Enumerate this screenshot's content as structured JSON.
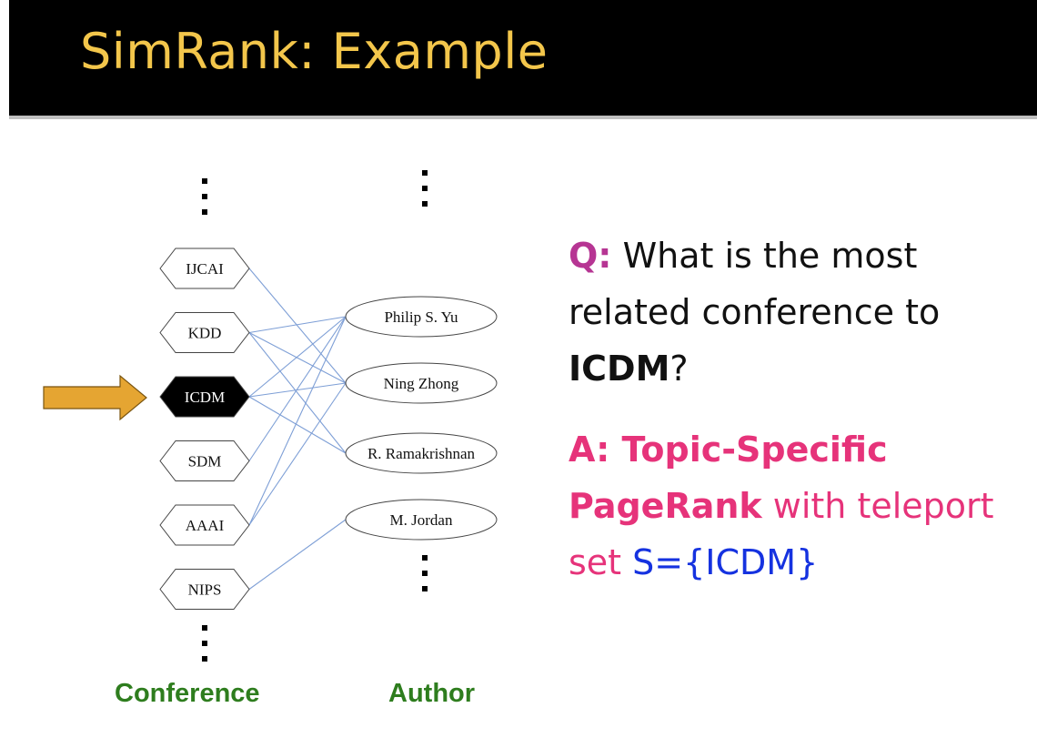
{
  "title": "SimRank: Example",
  "diagram": {
    "conferences": [
      "IJCAI",
      "KDD",
      "ICDM",
      "SDM",
      "AAAI",
      "NIPS"
    ],
    "highlighted_conference": "ICDM",
    "authors": [
      "Philip S. Yu",
      "Ning Zhong",
      "R. Ramakrishnan",
      "M. Jordan"
    ],
    "edges": [
      [
        "IJCAI",
        "Ning Zhong"
      ],
      [
        "KDD",
        "Philip S. Yu"
      ],
      [
        "KDD",
        "Ning Zhong"
      ],
      [
        "KDD",
        "R. Ramakrishnan"
      ],
      [
        "ICDM",
        "Philip S. Yu"
      ],
      [
        "ICDM",
        "Ning Zhong"
      ],
      [
        "ICDM",
        "R. Ramakrishnan"
      ],
      [
        "SDM",
        "Philip S. Yu"
      ],
      [
        "AAAI",
        "Philip S. Yu"
      ],
      [
        "AAAI",
        "Ning Zhong"
      ],
      [
        "NIPS",
        "M. Jordan"
      ]
    ],
    "conference_column_label": "Conference",
    "author_column_label": "Author"
  },
  "question": {
    "prefix": "Q:",
    "text_before": " What is the most related conference to ",
    "emphasis": "ICDM",
    "text_after": "?"
  },
  "answer": {
    "bold_part": "A: Topic-Specific PageRank",
    "text_part": " with teleport set ",
    "set_part": "S={ICDM}"
  },
  "colors": {
    "title": "#f3c64b",
    "header_background": "#000000",
    "question_prefix": "#b63593",
    "answer": "#e6337a",
    "teleport_set": "#1532e0",
    "column_labels": "#2e7d1e",
    "edges": "#7e9fd6",
    "arrow": "#e5a532"
  }
}
